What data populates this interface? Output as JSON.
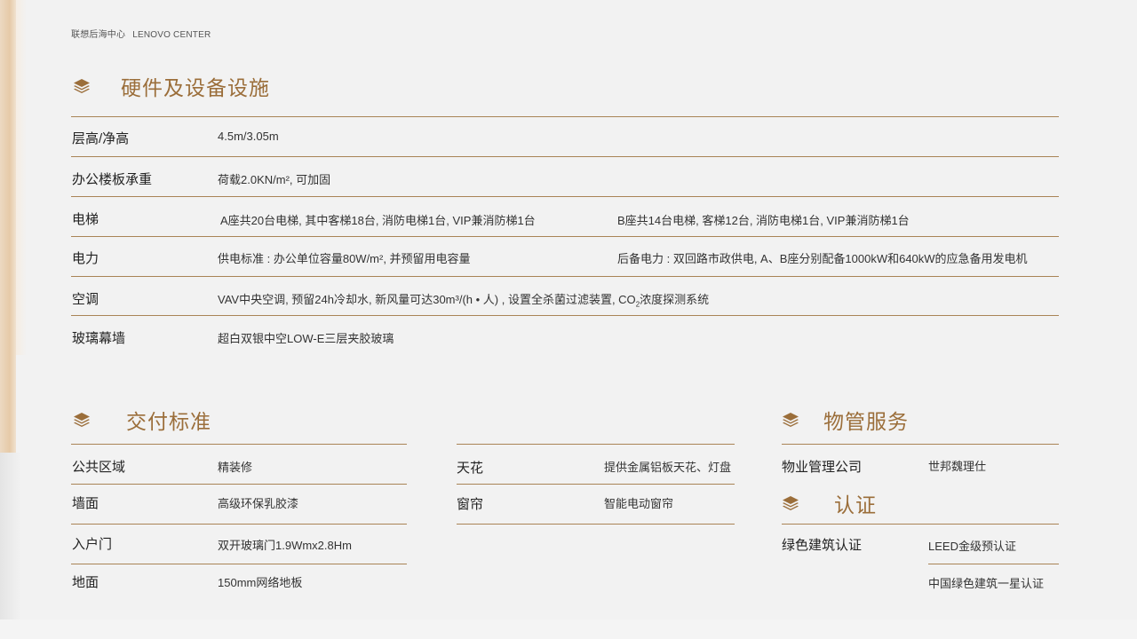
{
  "header": {
    "brand_cn": "联想后海中心",
    "brand_en": "LENOVO CENTER"
  },
  "colors": {
    "accent": "#9b6e3a",
    "divider": "#a98456",
    "background": "#f2f2f2"
  },
  "hardware": {
    "title": "硬件及设备设施",
    "icon": "layers-icon",
    "rows": [
      {
        "label": "层高/净高",
        "value": "4.5m/3.05m",
        "value2": ""
      },
      {
        "label": "办公楼板承重",
        "value": "荷载2.0KN/m², 可加固",
        "value2": ""
      },
      {
        "label": "电梯",
        "value": "A座共20台电梯, 其中客梯18台, 消防电梯1台, VIP兼消防梯1台",
        "value2": "B座共14台电梯, 客梯12台, 消防电梯1台, VIP兼消防梯1台"
      },
      {
        "label": "电力",
        "value": "供电标准 : 办公单位容量80W/m², 并预留用电容量",
        "value2": "后备电力 : 双回路市政供电, A、B座分别配备1000kW和640kW的应急备用发电机"
      },
      {
        "label": "空调",
        "value_pre": "VAV中央空调, 预留24h冷却水, 新风量可达30m³/(h • 人) , 设置全杀菌过滤装置, CO",
        "value_sub": "2",
        "value_post": "浓度探测系统"
      },
      {
        "label": "玻璃幕墙",
        "value": "超白双银中空LOW-E三层夹胶玻璃",
        "value2": ""
      }
    ]
  },
  "delivery": {
    "title": "交付标准",
    "icon": "layers-icon",
    "left_rows": [
      {
        "label": "公共区域",
        "value": "精装修"
      },
      {
        "label": "墙面",
        "value": "高级环保乳胶漆"
      },
      {
        "label": "入户门",
        "value": "双开玻璃门1.9Wmx2.8Hm"
      },
      {
        "label": "地面",
        "value": "150mm网络地板"
      }
    ],
    "right_rows": [
      {
        "label": "天花",
        "value": "提供金属铝板天花、灯盘"
      },
      {
        "label": "窗帘",
        "value": "智能电动窗帘"
      }
    ]
  },
  "property": {
    "title": "物管服务",
    "icon": "layers-icon",
    "rows": [
      {
        "label": "物业管理公司",
        "value": "世邦魏理仕"
      }
    ]
  },
  "certification": {
    "title": "认证",
    "icon": "layers-icon",
    "rows": [
      {
        "label": "绿色建筑认证",
        "value": "LEED金级预认证"
      },
      {
        "label": "",
        "value": "中国绿色建筑一星认证"
      }
    ]
  }
}
